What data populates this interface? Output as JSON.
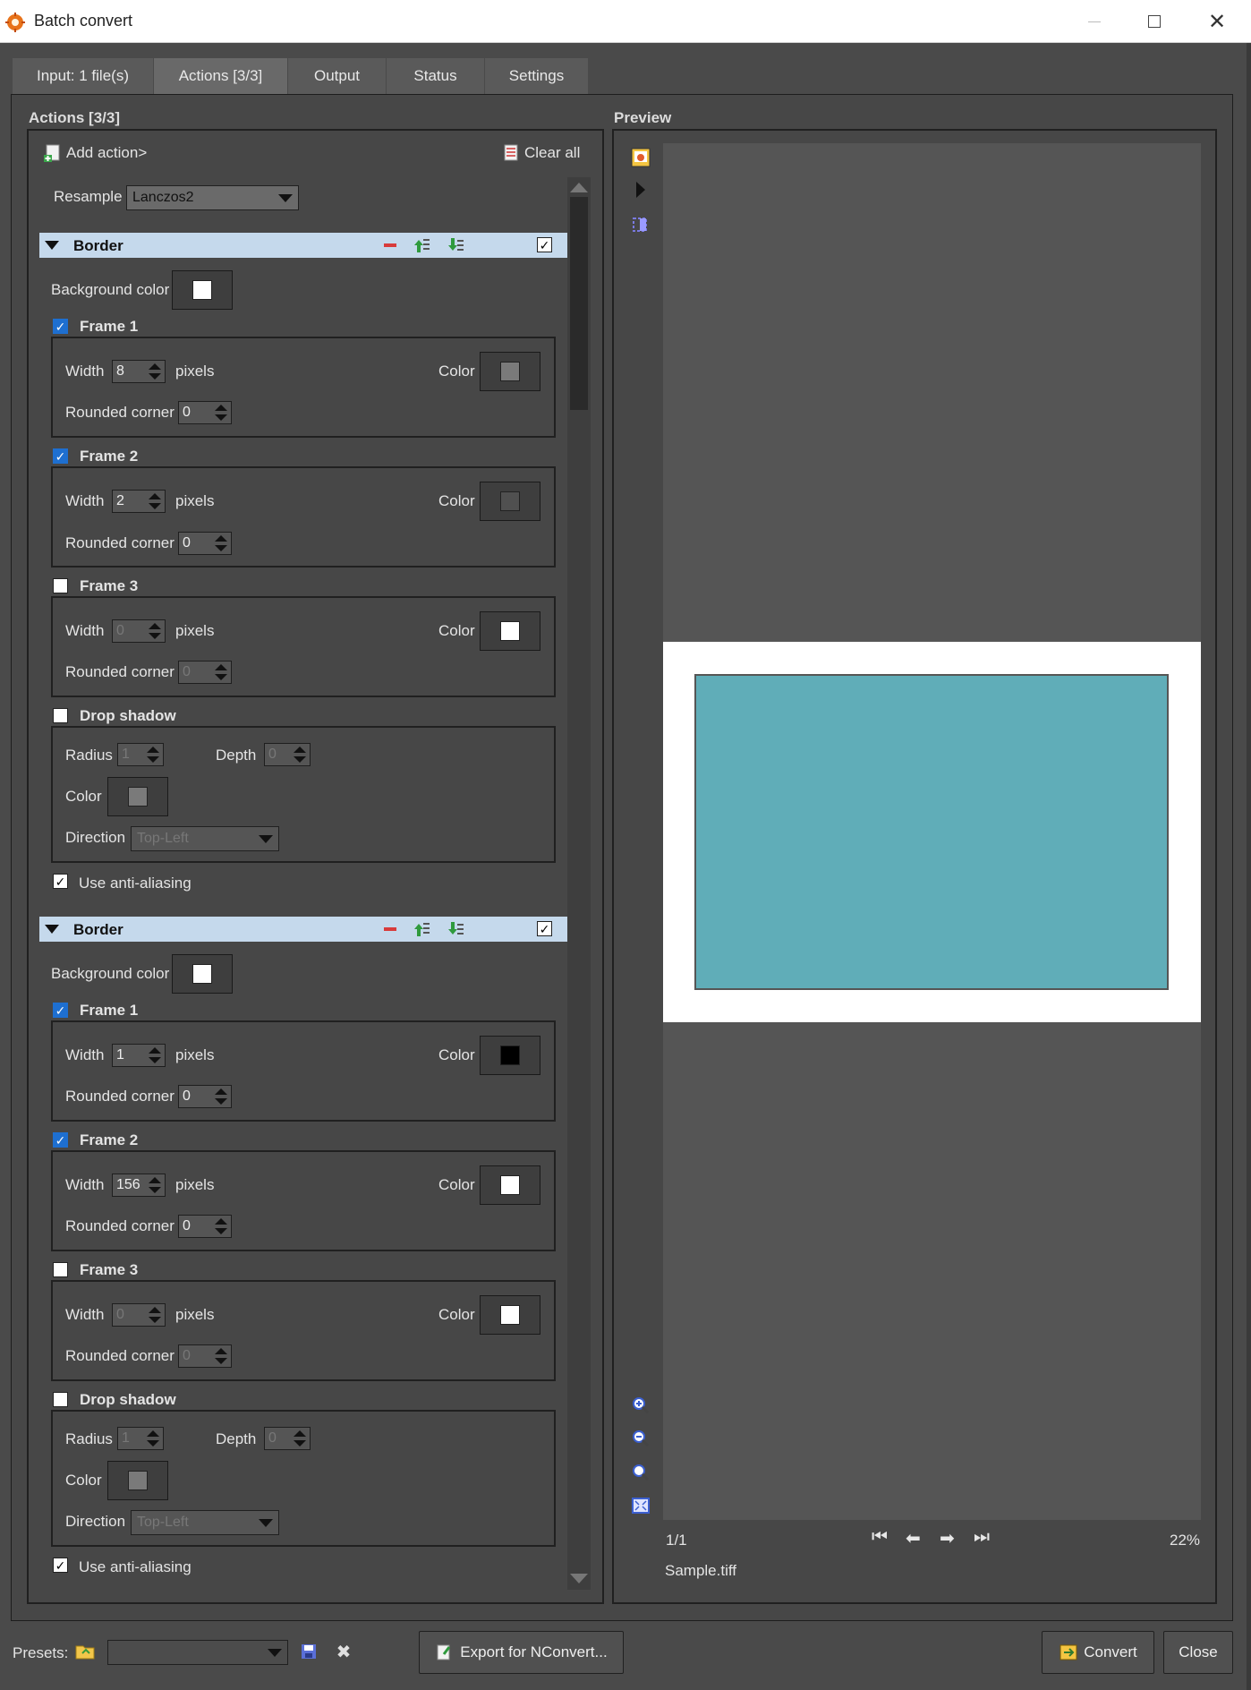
{
  "window": {
    "title": "Batch convert"
  },
  "tabs": [
    {
      "label": "Input: 1 file(s)"
    },
    {
      "label": "Actions [3/3]"
    },
    {
      "label": "Output"
    },
    {
      "label": "Status"
    },
    {
      "label": "Settings"
    }
  ],
  "actions_panel": {
    "title": "Actions [3/3]",
    "add_action": "Add action>",
    "clear_all": "Clear all",
    "resample_label": "Resample",
    "resample_value": "Lanczos2"
  },
  "labels": {
    "border": "Border",
    "background_color": "Background color",
    "frame1": "Frame 1",
    "frame2": "Frame 2",
    "frame3": "Frame 3",
    "width": "Width",
    "pixels": "pixels",
    "color": "Color",
    "rounded_corner": "Rounded corner",
    "drop_shadow": "Drop shadow",
    "radius": "Radius",
    "depth": "Depth",
    "direction": "Direction",
    "use_antialiasing": "Use anti-aliasing"
  },
  "border1": {
    "background_color": "#ffffff",
    "frame1": {
      "checked": true,
      "width": "8",
      "rounded": "0",
      "color": "#7a7a7a"
    },
    "frame2": {
      "checked": true,
      "width": "2",
      "rounded": "0",
      "color": "#505050"
    },
    "frame3": {
      "checked": false,
      "width": "0",
      "rounded": "0",
      "color": "#ffffff"
    },
    "drop_shadow": {
      "checked": false,
      "radius": "1",
      "depth": "0",
      "color": "#7a7a7a",
      "direction": "Top-Left"
    },
    "antialiasing": true
  },
  "border2": {
    "background_color": "#ffffff",
    "frame1": {
      "checked": true,
      "width": "1",
      "rounded": "0",
      "color": "#000000"
    },
    "frame2": {
      "checked": true,
      "width": "156",
      "rounded": "0",
      "color": "#ffffff"
    },
    "frame3": {
      "checked": false,
      "width": "0",
      "rounded": "0",
      "color": "#ffffff"
    },
    "drop_shadow": {
      "checked": false,
      "radius": "1",
      "depth": "0",
      "color": "#7a7a7a",
      "direction": "Top-Left"
    },
    "antialiasing": true
  },
  "preview": {
    "title": "Preview",
    "page": "1/1",
    "zoom": "22%",
    "filename": "Sample.tiff",
    "image_color": "#60adb8"
  },
  "footer": {
    "presets_label": "Presets:",
    "export_button": "Export for NConvert...",
    "convert_button": "Convert",
    "close_button": "Close"
  }
}
